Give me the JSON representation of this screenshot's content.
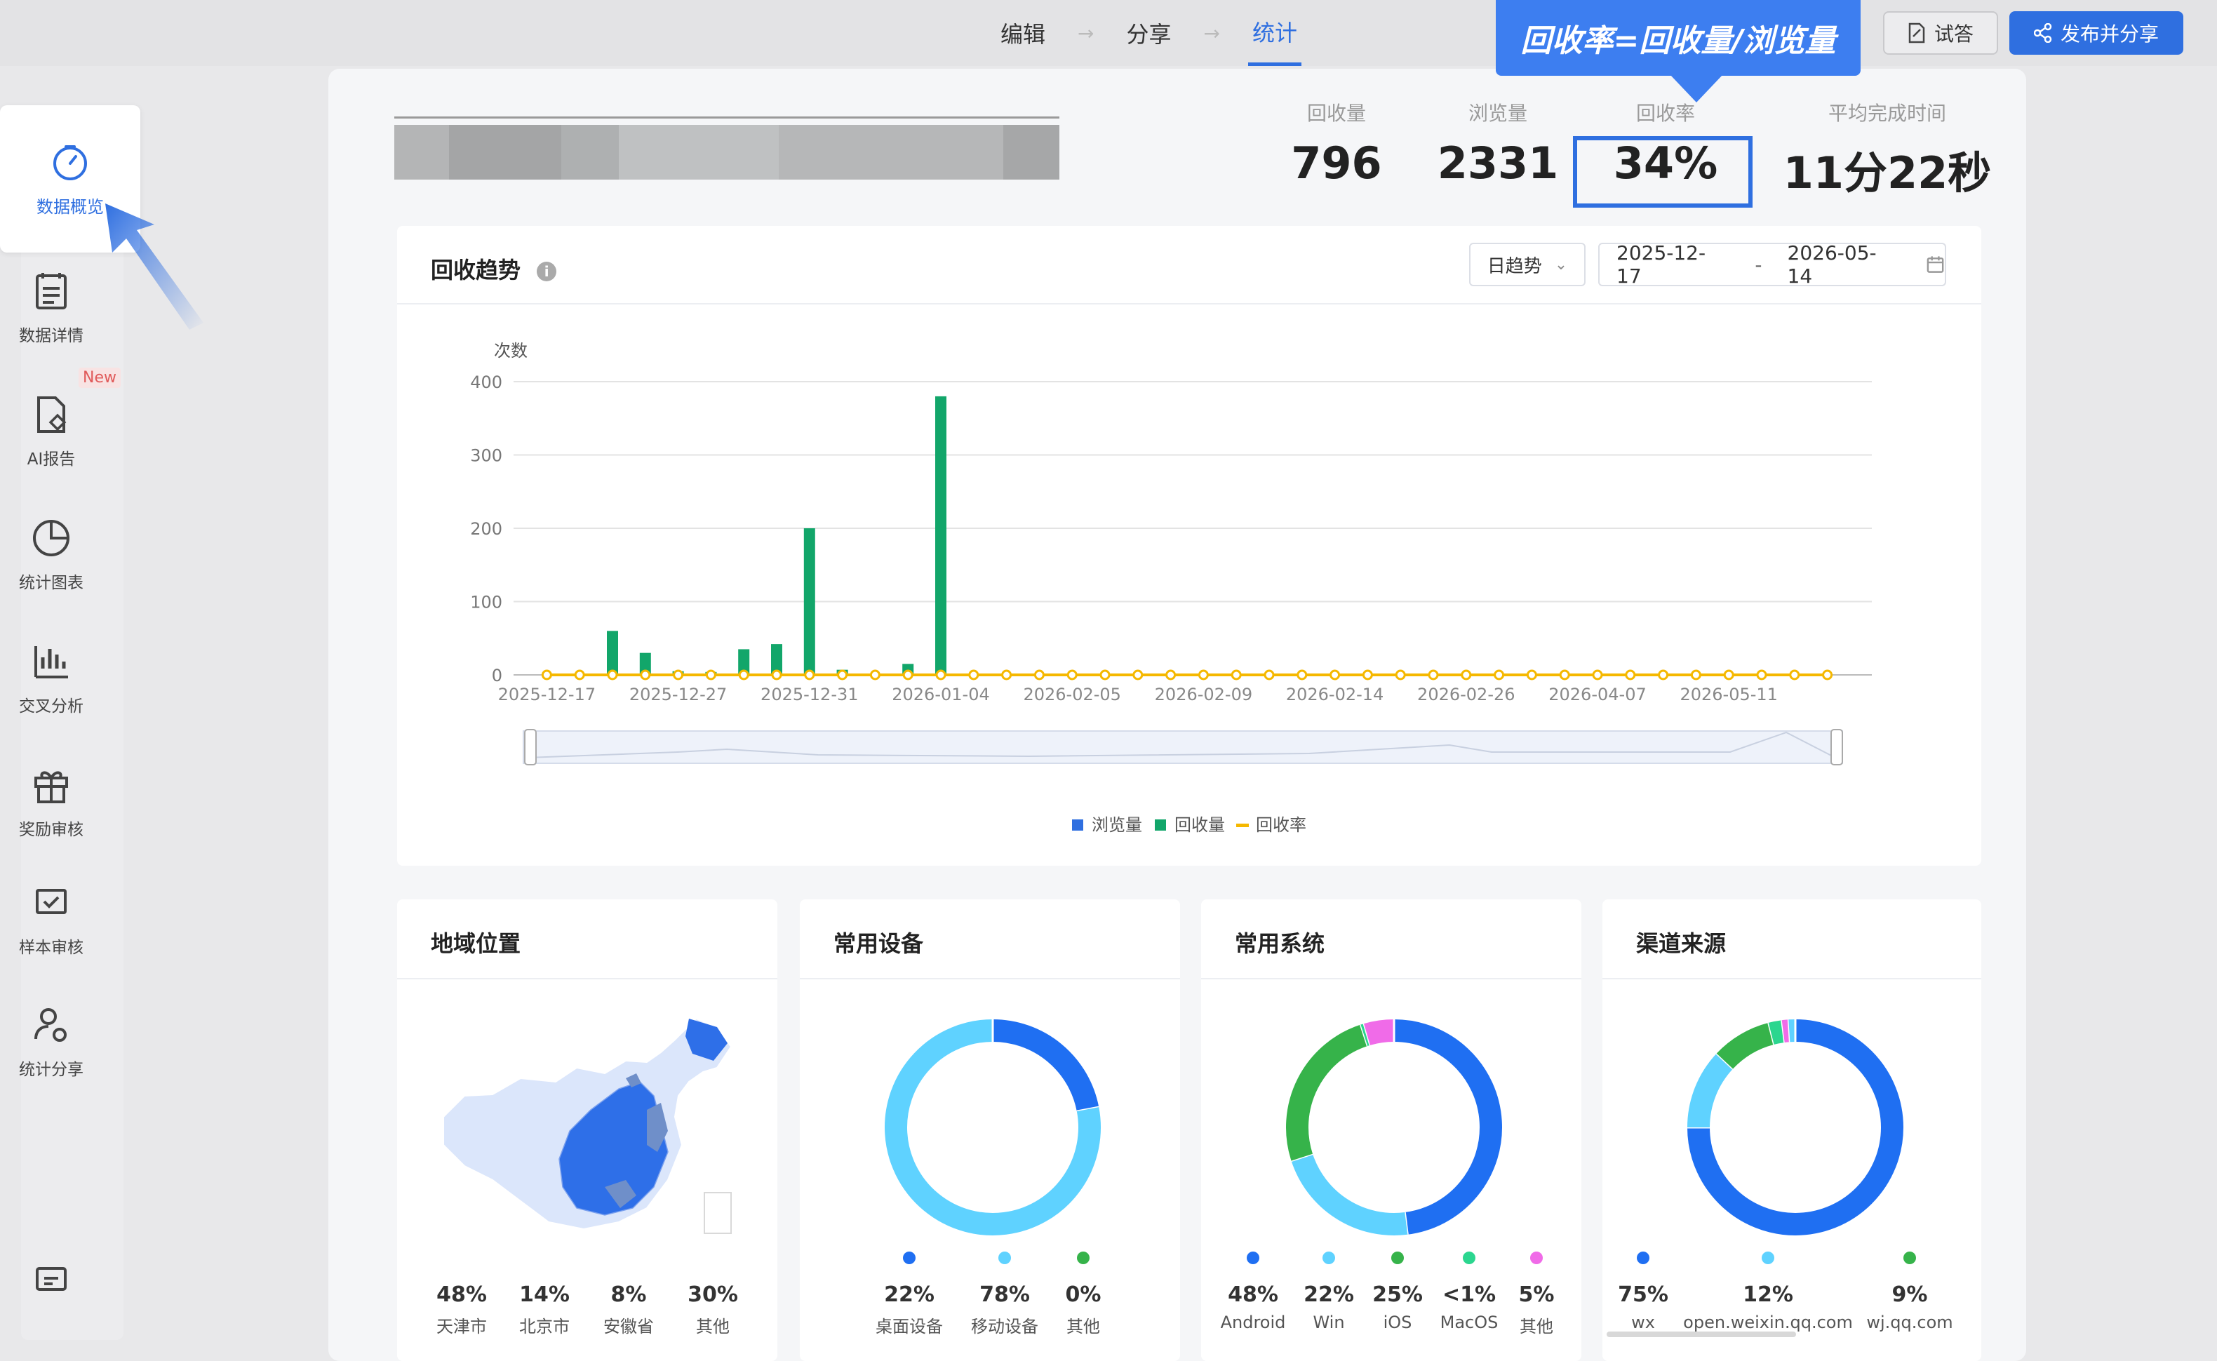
{
  "nav": {
    "steps": [
      "编辑",
      "分享",
      "统计"
    ],
    "active_step": "统计",
    "try_button": "试答",
    "publish_button": "发布并分享"
  },
  "callout": "回收率=回收量/浏览量",
  "sidebar": {
    "items": [
      {
        "label": "数据概览",
        "icon": "dashboard-icon",
        "active": true
      },
      {
        "label": "数据详情",
        "icon": "clipboard-icon"
      },
      {
        "label": "AI报告",
        "icon": "ai-report-icon"
      },
      {
        "label": "统计图表",
        "icon": "pie-chart-icon"
      },
      {
        "label": "交叉分析",
        "icon": "bar-chart-icon"
      },
      {
        "label": "奖励审核",
        "icon": "gift-icon"
      },
      {
        "label": "样本审核",
        "icon": "check-board-icon"
      },
      {
        "label": "统计分享",
        "icon": "user-share-icon"
      }
    ],
    "new_badge": "New",
    "feedback_icon": "message-icon"
  },
  "kpis": [
    {
      "label": "回收量",
      "value": "796"
    },
    {
      "label": "浏览量",
      "value": "2331"
    },
    {
      "label": "回收率",
      "value": "34%"
    },
    {
      "label": "平均完成时间",
      "value": "11分22秒"
    }
  ],
  "trend": {
    "title": "回收趋势",
    "select_value": "日趋势",
    "date_start": "2025-12-17",
    "date_sep": "-",
    "date_end": "2026-05-14",
    "colors": {
      "browse": "#2f6fe0",
      "collect": "#12a66a",
      "rate": "#f5b800"
    }
  },
  "chart_data": {
    "type": "bar",
    "ylabel": "次数",
    "ylim": [
      0,
      400
    ],
    "yticks": [
      0,
      100,
      200,
      300,
      400
    ],
    "x_tick_labels": [
      "2025-12-17",
      "2025-12-27",
      "2025-12-31",
      "2026-01-04",
      "2026-02-05",
      "2026-02-09",
      "2026-02-14",
      "2026-02-26",
      "2026-04-07",
      "2026-05-11"
    ],
    "points": 40,
    "series": [
      {
        "name": "浏览量",
        "type": "bar",
        "values": [
          0,
          0,
          0,
          0,
          0,
          0,
          0,
          0,
          0,
          0,
          0,
          0,
          0,
          0,
          0,
          0,
          0,
          0,
          0,
          0,
          0,
          0,
          0,
          0,
          0,
          0,
          0,
          0,
          0,
          0,
          0,
          0,
          0,
          0,
          0,
          0,
          0,
          2,
          0,
          0
        ]
      },
      {
        "name": "回收量",
        "type": "bar",
        "values": [
          0,
          0,
          0,
          0,
          0,
          0,
          0,
          0,
          0,
          0,
          0,
          0,
          0,
          0,
          0,
          0,
          0,
          0,
          0,
          0,
          0,
          0,
          0,
          0,
          0,
          0,
          0,
          0,
          0,
          0,
          0,
          0,
          0,
          0,
          0,
          0,
          0,
          0,
          0,
          0
        ]
      },
      {
        "name": "回收率",
        "type": "line",
        "values": [
          0,
          0,
          0,
          0,
          0,
          0,
          0,
          0,
          0,
          0,
          0,
          0,
          0,
          0,
          0,
          0,
          0,
          0,
          0,
          0,
          0,
          0,
          0,
          0,
          0,
          0,
          0,
          0,
          0,
          0,
          0,
          0,
          0,
          0,
          0,
          0,
          0,
          0,
          0,
          0
        ]
      }
    ],
    "collect_nonzero": [
      {
        "index": 2,
        "value": 60
      },
      {
        "index": 3,
        "value": 30
      },
      {
        "index": 4,
        "value": 5
      },
      {
        "index": 5,
        "value": 4
      },
      {
        "index": 6,
        "value": 35
      },
      {
        "index": 7,
        "value": 42
      },
      {
        "index": 8,
        "value": 200
      },
      {
        "index": 9,
        "value": 7
      },
      {
        "index": 11,
        "value": 15
      },
      {
        "index": 12,
        "value": 380
      }
    ],
    "legend": [
      "浏览量",
      "回收量",
      "回收率"
    ]
  },
  "cards": [
    {
      "title": "地域位置",
      "items": [
        {
          "pct": "48%",
          "name": "天津市"
        },
        {
          "pct": "14%",
          "name": "北京市"
        },
        {
          "pct": "8%",
          "name": "安徽省"
        },
        {
          "pct": "30%",
          "name": "其他"
        }
      ]
    },
    {
      "title": "常用设备",
      "items": [
        {
          "pct": "22%",
          "name": "桌面设备",
          "color": "#1f6ff2",
          "value": 22
        },
        {
          "pct": "78%",
          "name": "移动设备",
          "color": "#5fd2ff",
          "value": 78
        },
        {
          "pct": "0%",
          "name": "其他",
          "color": "#36b34a",
          "value": 0
        }
      ]
    },
    {
      "title": "常用系统",
      "items": [
        {
          "pct": "48%",
          "name": "Android",
          "color": "#1f6ff2",
          "value": 48
        },
        {
          "pct": "22%",
          "name": "Win",
          "color": "#5fd2ff",
          "value": 22
        },
        {
          "pct": "25%",
          "name": "iOS",
          "color": "#36b34a",
          "value": 25
        },
        {
          "pct": "<1%",
          "name": "MacOS",
          "color": "#2bd68f",
          "value": 0.5
        },
        {
          "pct": "5%",
          "name": "其他",
          "color": "#f06be8",
          "value": 4.5
        }
      ]
    },
    {
      "title": "渠道来源",
      "items": [
        {
          "pct": "75%",
          "name": "wx",
          "color": "#1f6ff2",
          "value": 75
        },
        {
          "pct": "12%",
          "name": "open.weixin.qq.com",
          "color": "#5fd2ff",
          "value": 12
        },
        {
          "pct": "9%",
          "name": "wj.qq.com",
          "color": "#36b34a",
          "value": 9
        }
      ],
      "extra_slices": [
        {
          "color": "#2bd68f",
          "value": 2
        },
        {
          "color": "#f06be8",
          "value": 1
        },
        {
          "color": "#5fd2ff",
          "value": 1
        }
      ]
    }
  ]
}
